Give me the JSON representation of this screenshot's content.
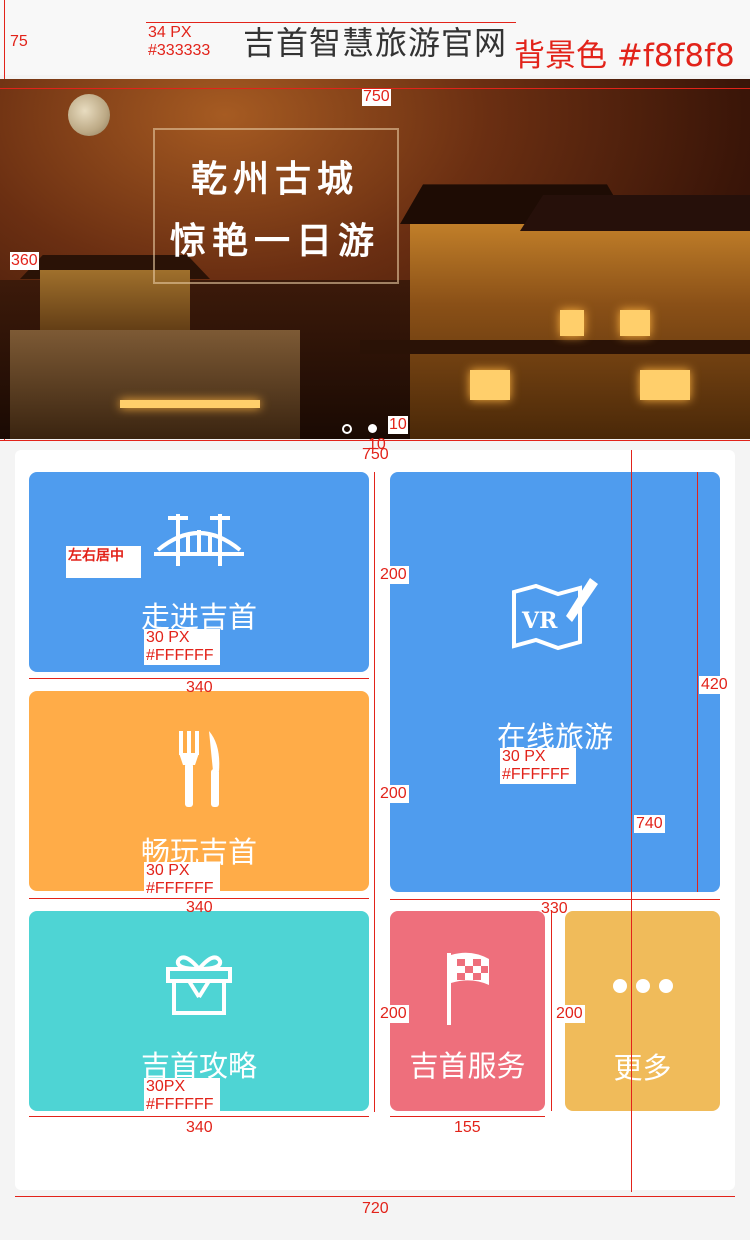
{
  "header": {
    "title": "吉首智慧旅游官网",
    "bg_note": "背景色 #f8f8f8",
    "height_label": "75",
    "font_note_size": "34 PX",
    "font_note_color": "#333333"
  },
  "banner": {
    "width_label": "750",
    "height_label": "360",
    "headline_line1": "乾州古城",
    "headline_line2": "惊艳一日游",
    "dot_size_label": "10",
    "gap_label": "10",
    "active_dot": 2,
    "dot_count": 2
  },
  "grid": {
    "panel_width_label": "750",
    "panel_total_width_label": "720",
    "panel_height_label": "740",
    "tiles": [
      {
        "label": "走进吉首",
        "color": "#4f9cee",
        "icon": "bridge-icon",
        "size_note": "30 PX",
        "color_note": "#FFFFFF",
        "width_label": "340",
        "height_label": "200",
        "center_note": "左右居中"
      },
      {
        "label": "在线旅游",
        "color": "#4f9cee",
        "icon": "vr-map-icon",
        "size_note": "30 PX",
        "color_note": "#FFFFFF",
        "width_label": "330",
        "height_label": "420"
      },
      {
        "label": "畅玩吉首",
        "color": "#ffac48",
        "icon": "fork-knife-icon",
        "size_note": "30 PX",
        "color_note": "#FFFFFF",
        "width_label": "340",
        "height_label": "200"
      },
      {
        "label": "吉首攻略",
        "color": "#4ed4d4",
        "icon": "gift-icon",
        "size_note": "30PX",
        "color_note": "#FFFFFF",
        "width_label": "340",
        "height_label": "200"
      },
      {
        "label": "吉首服务",
        "color": "#ee6f7c",
        "icon": "flag-icon",
        "width_label": "155",
        "height_label": "200"
      },
      {
        "label": "更多",
        "color": "#f0bb5a",
        "icon": "more-icon",
        "height_label": "200"
      }
    ]
  }
}
